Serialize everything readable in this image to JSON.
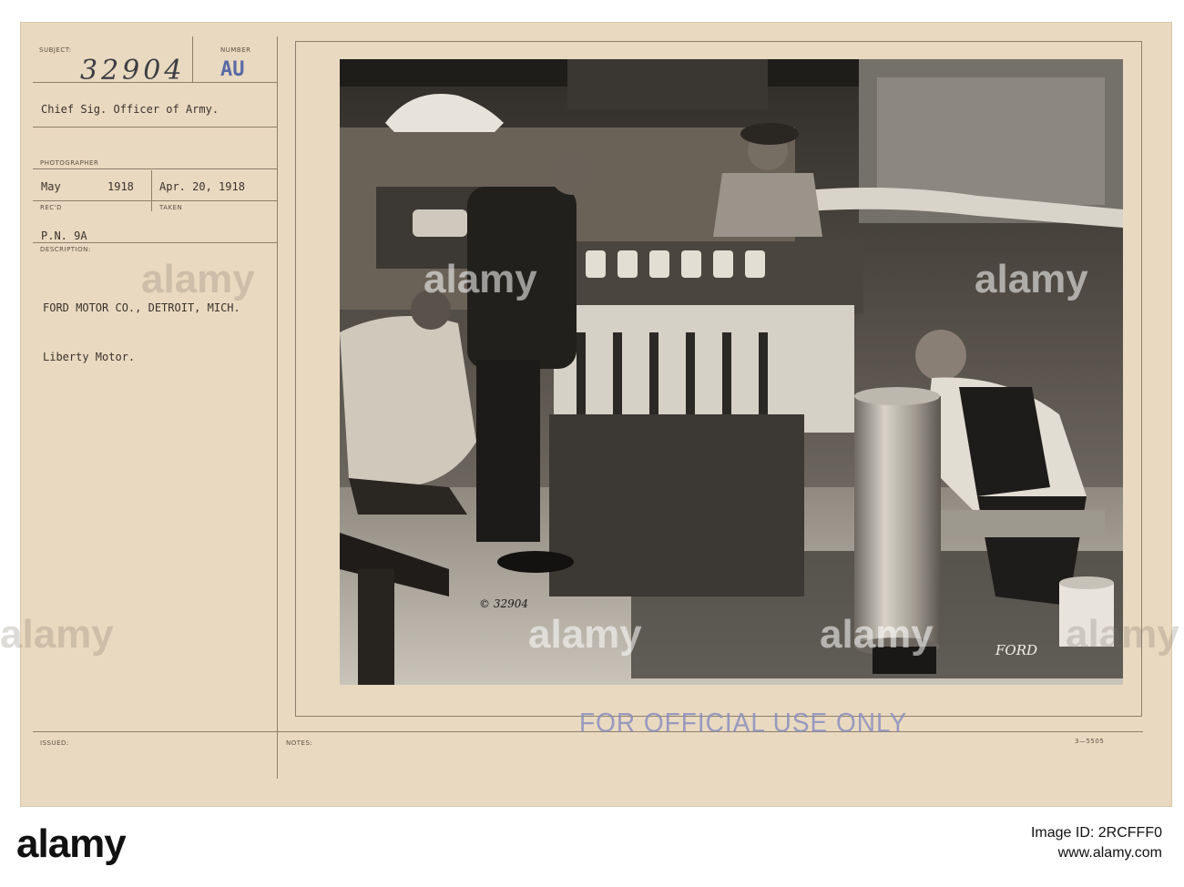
{
  "card": {
    "labels": {
      "subject": "SUBJECT:",
      "number": "NUMBER",
      "photographer": "PHOTOGRAPHER",
      "recd": "REC'D",
      "taken": "TAKEN",
      "description": "DESCRIPTION:",
      "issued": "ISSUED:",
      "notes": "NOTES:"
    },
    "subject_number": "32904",
    "number_code": "AU",
    "owner": "Chief Sig. Officer of Army.",
    "received_month": "May",
    "received_year": "1918",
    "taken_date": "Apr. 20, 1918",
    "pn": "P.N. 9A",
    "description_line1": "FORD MOTOR CO., DETROIT, MICH.",
    "description_line2": "Liberty Motor.",
    "form_code": "3—5505",
    "stamp": "FOR OFFICIAL USE ONLY"
  },
  "photo": {
    "inscription_number": "© 32904",
    "inscription_brand": "FORD"
  },
  "watermark": "alamy",
  "footer": {
    "logo": "alamy",
    "image_id": "Image ID: 2RCFFF0",
    "url": "www.alamy.com"
  }
}
